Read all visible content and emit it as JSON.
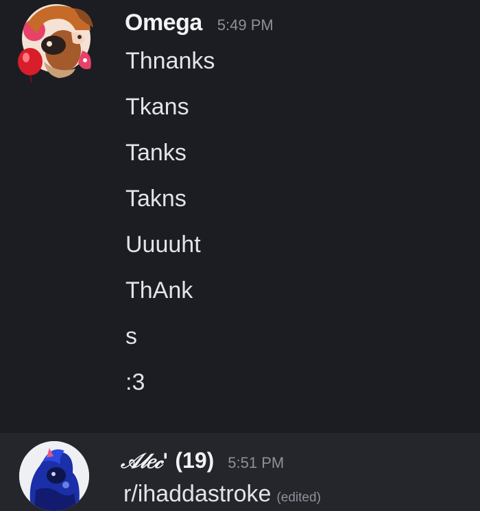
{
  "messages": [
    {
      "username": "Omega",
      "timestamp": "5:49 PM",
      "avatar_icon": "anime-avatar-icon",
      "lines": [
        "Thnanks",
        "Tkans",
        "Tanks",
        "Takns",
        "Uuuuht",
        "ThAnk",
        "s",
        ":3"
      ]
    },
    {
      "username": "𝒜𝓁𝑒𝒸'",
      "age": "(19)",
      "timestamp": "5:51 PM",
      "avatar_icon": "blue-figure-avatar-icon",
      "text": "r/ihaddastroke",
      "edited_label": "(edited)"
    }
  ],
  "colors": {
    "background": "#1c1d22",
    "hover_background": "#25262c",
    "text": "#e3e4e8",
    "muted": "#8e9199"
  }
}
